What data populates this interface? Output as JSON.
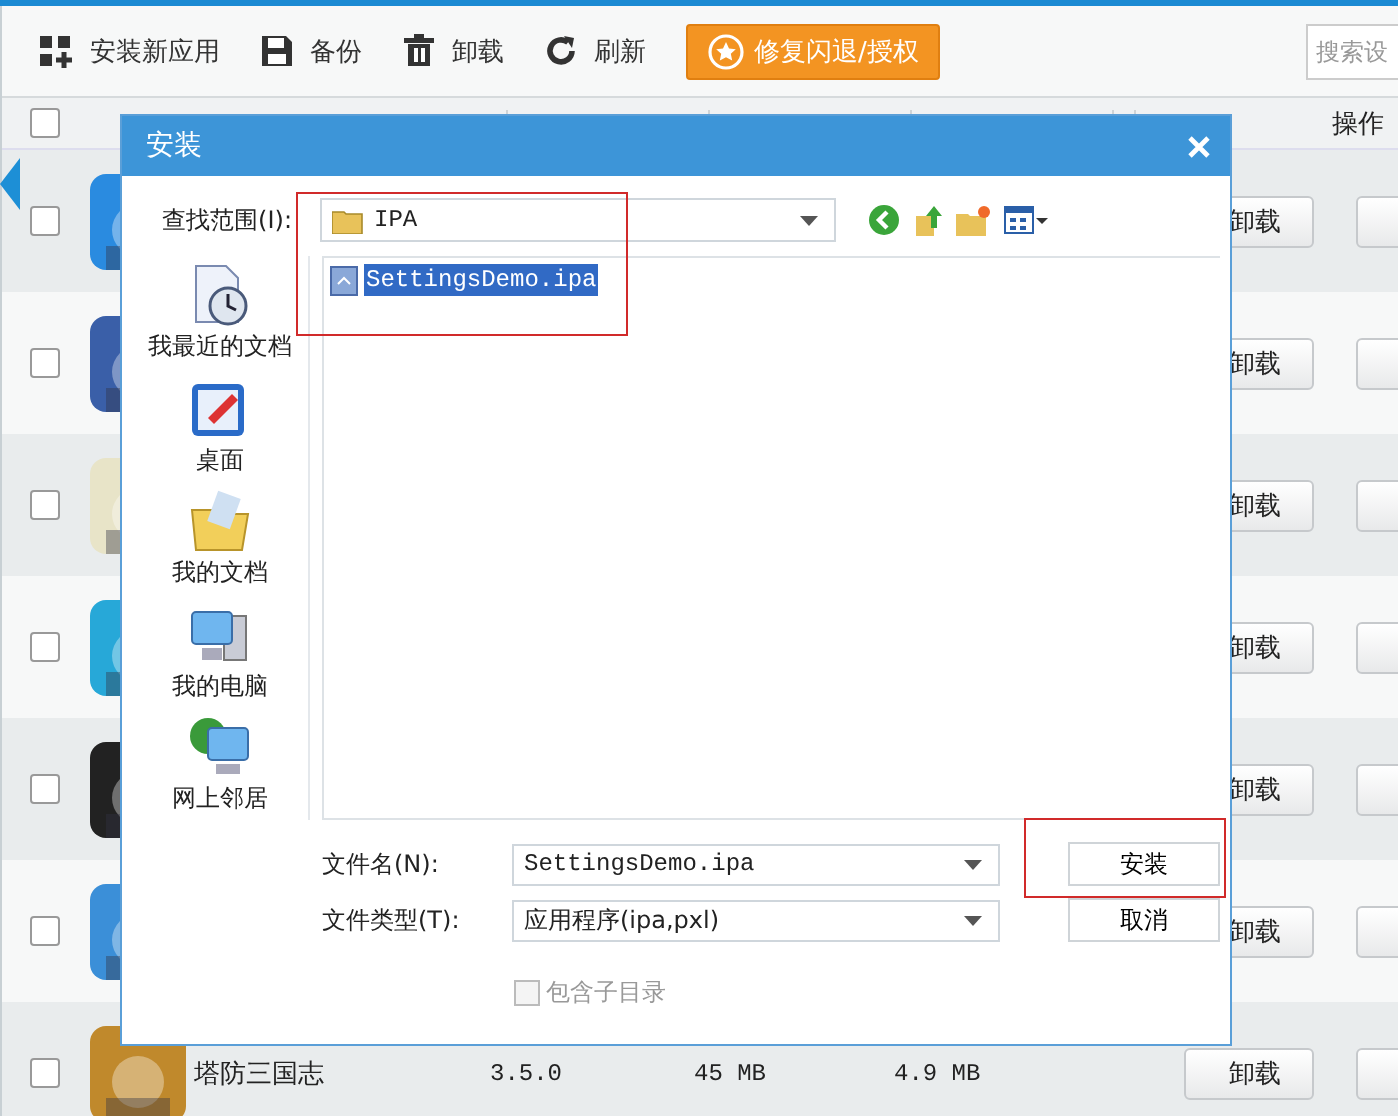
{
  "toolbar": {
    "buttons": [
      {
        "kind": "grid",
        "label": "安装新应用"
      },
      {
        "kind": "save",
        "label": "备份"
      },
      {
        "kind": "trash",
        "label": "卸载"
      },
      {
        "kind": "refresh",
        "label": "刷新"
      }
    ],
    "repair_button": "修复闪退/授权",
    "search": {
      "placeholder": "搜索设"
    }
  },
  "table": {
    "select_all": {
      "checked": false
    },
    "columns": [
      {
        "label": "操作"
      }
    ],
    "rows": [
      {
        "checked": false,
        "action": "卸载"
      },
      {
        "checked": false,
        "action": "卸载"
      },
      {
        "checked": false,
        "action": "卸载"
      },
      {
        "checked": false,
        "action": "卸载"
      },
      {
        "checked": false,
        "action": "卸载"
      },
      {
        "checked": false,
        "action": "卸载"
      },
      {
        "checked": false,
        "name": "塔防三国志",
        "version": "3.5.0",
        "size": "45 MB",
        "data_size": "4.9 MB",
        "action": "卸载"
      }
    ]
  },
  "dialog": {
    "title": "安装",
    "look_in_label": "查找范围(I):",
    "look_in": "IPA",
    "places": [
      {
        "kind": "recent",
        "label": "我最近的文档"
      },
      {
        "kind": "desktop",
        "label": "桌面"
      },
      {
        "kind": "documents",
        "label": "我的文档"
      },
      {
        "kind": "computer",
        "label": "我的电脑"
      },
      {
        "kind": "network",
        "label": "网上邻居"
      }
    ],
    "files": [
      {
        "name": "SettingsDemo.ipa",
        "selected": true
      }
    ],
    "file_name_label": "文件名(N):",
    "file_name": "SettingsDemo.ipa",
    "file_type_label": "文件类型(T):",
    "file_type": "应用程序(ipa,pxl)",
    "buttons": [
      "安装",
      "取消"
    ],
    "include_subfolders": {
      "label": "包含子目录",
      "checked": false,
      "disabled": true
    }
  }
}
